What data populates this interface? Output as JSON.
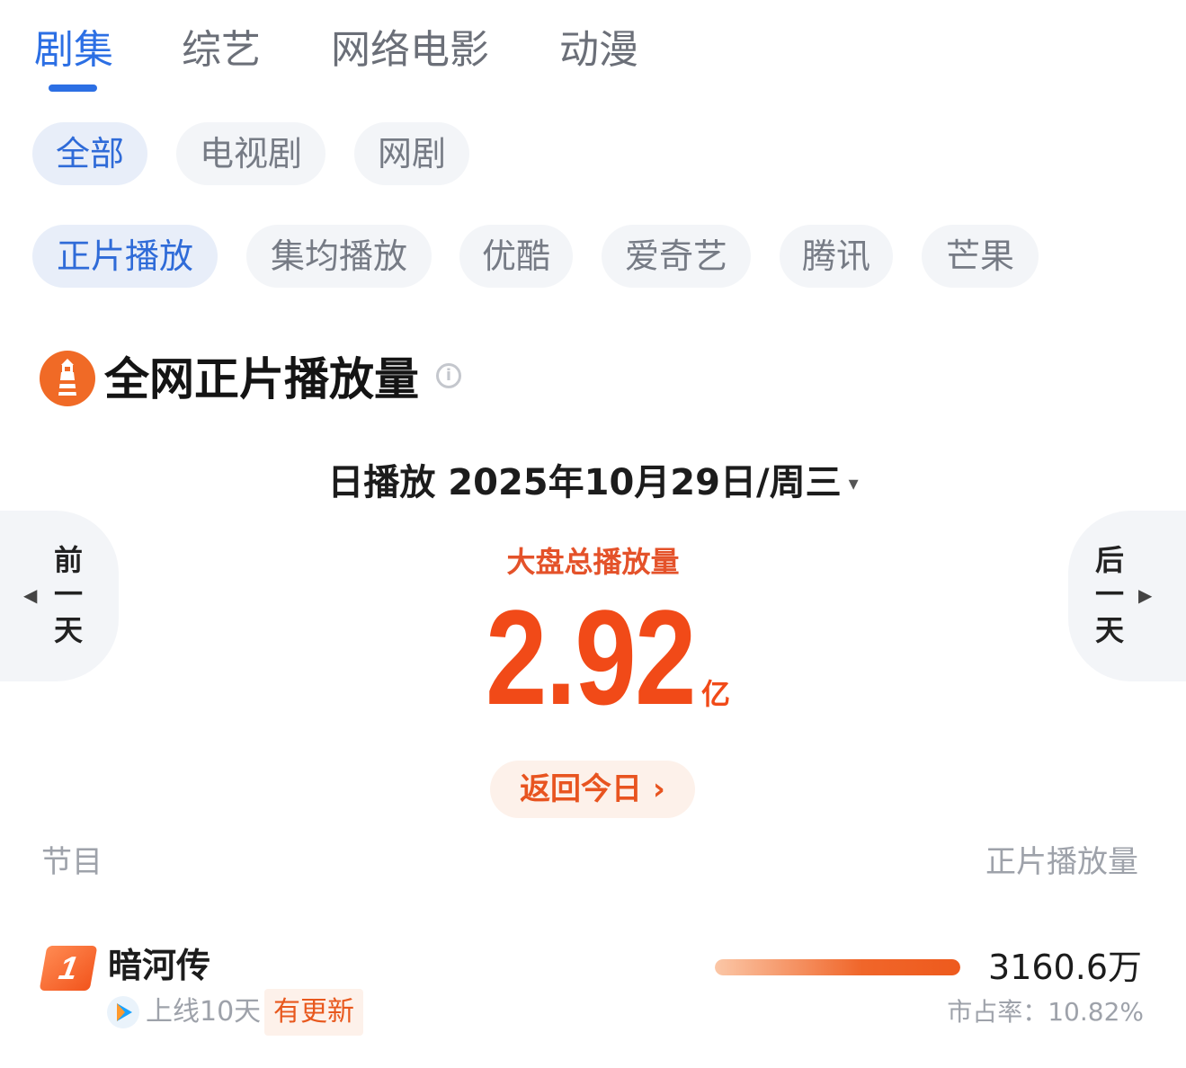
{
  "top_tabs": [
    {
      "label": "剧集",
      "active": true
    },
    {
      "label": "综艺",
      "active": false
    },
    {
      "label": "网络电影",
      "active": false
    },
    {
      "label": "动漫",
      "active": false
    }
  ],
  "type_filters": [
    {
      "label": "全部",
      "active": true
    },
    {
      "label": "电视剧",
      "active": false
    },
    {
      "label": "网剧",
      "active": false
    }
  ],
  "metric_filters": [
    {
      "label": "正片播放",
      "active": true
    },
    {
      "label": "集均播放",
      "active": false
    },
    {
      "label": "优酷",
      "active": false
    },
    {
      "label": "爱奇艺",
      "active": false
    },
    {
      "label": "腾讯",
      "active": false
    },
    {
      "label": "芒果",
      "active": false
    }
  ],
  "section": {
    "title": "全网正片播放量",
    "info_icon": "info-icon",
    "logo_icon": "lighthouse-icon"
  },
  "date": {
    "text": "日播放 2025年10月29日/周三",
    "caret": "▾"
  },
  "nav": {
    "prev": {
      "label": [
        "前",
        "一",
        "天"
      ],
      "arrow": "◀"
    },
    "next": {
      "label": [
        "后",
        "一",
        "天"
      ],
      "arrow": "▶"
    }
  },
  "total": {
    "label": "大盘总播放量",
    "value": "2.92",
    "unit": "亿"
  },
  "back_today": "返回今日 ›",
  "table": {
    "col_program": "节目",
    "col_plays": "正片播放量",
    "rows": [
      {
        "rank": "1",
        "title": "暗河传",
        "online": "上线10天",
        "tag": "有更新",
        "plays": "3160.6万",
        "share": "市占率：10.82%",
        "bar_fraction": 1.0
      }
    ]
  },
  "colors": {
    "accent_blue": "#2c6fe4",
    "accent_orange": "#f14a18"
  }
}
